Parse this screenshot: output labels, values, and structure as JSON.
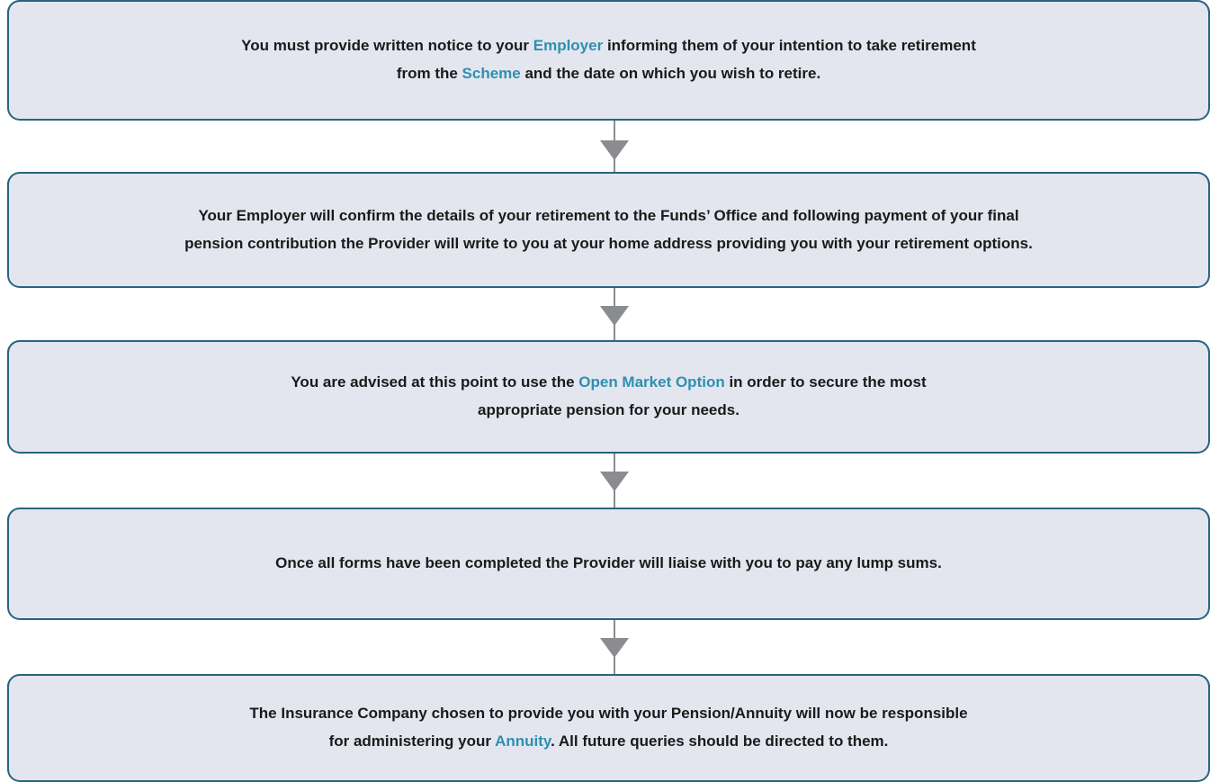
{
  "colors": {
    "box_fill": "#e3e6ef",
    "box_border": "#27657f",
    "highlight_text": "#2f8fb0",
    "body_text": "#1a1a1a",
    "arrow": "#8a8c90"
  },
  "steps": [
    {
      "line1": {
        "a": "You must provide written notice to your ",
        "hl1": "Employer",
        "b": " informing them of your intention to take retirement"
      },
      "line2": {
        "a": "from the ",
        "hl1": "Scheme",
        "b": " and the date on which you wish to retire."
      }
    },
    {
      "line1": "Your Employer will confirm the details of your retirement to the Funds’ Office and following payment of your final",
      "line2": "pension contribution the Provider will write to you at your home address providing you with your retirement options."
    },
    {
      "line1": {
        "a": "You are advised at this point to use the ",
        "hl1": "Open Market Option",
        "b": " in order to secure the most"
      },
      "line2": "appropriate pension for your needs."
    },
    {
      "line1": "Once all forms have been completed the Provider will liaise with you to pay any lump sums."
    },
    {
      "line1": "The Insurance Company chosen to provide you with your Pension/Annuity will now be responsible",
      "line2": {
        "a": "for administering your ",
        "hl1": "Annuity",
        "b": ". All future queries should be directed to them."
      }
    }
  ]
}
